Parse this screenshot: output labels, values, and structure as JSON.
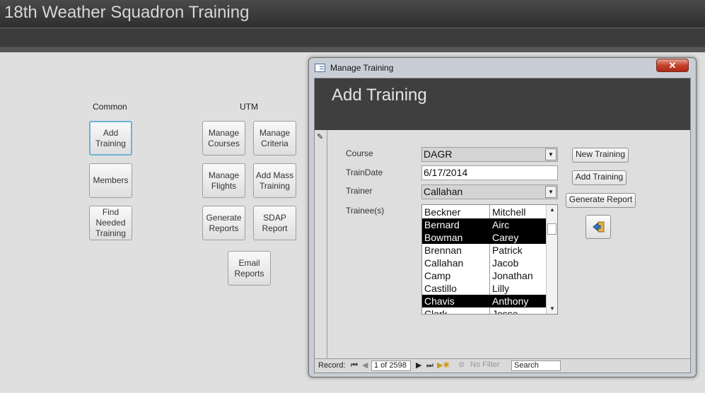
{
  "app": {
    "title": "18th Weather Squadron Training"
  },
  "groups": {
    "common_label": "Common",
    "utm_label": "UTM"
  },
  "buttons": {
    "add_training": "Add\nTraining",
    "members": "Members",
    "find_needed_training": "Find\nNeeded\nTraining",
    "manage_courses": "Manage\nCourses",
    "manage_criteria": "Manage\nCriteria",
    "manage_flights": "Manage\nFlights",
    "add_mass_training": "Add Mass\nTraining",
    "generate_reports": "Generate\nReports",
    "sdap_report": "SDAP\nReport",
    "email_reports": "Email\nReports"
  },
  "popup": {
    "window_title": "Manage Training",
    "close_glyph": "✕",
    "heading": "Add Training",
    "labels": {
      "course": "Course",
      "train_date": "TrainDate",
      "trainer": "Trainer",
      "trainees": "Trainee(s)"
    },
    "fields": {
      "course": "DAGR",
      "train_date": "6/17/2014",
      "trainer": "Callahan"
    },
    "side_buttons": {
      "new_training": "New Training",
      "add_training": "Add Training",
      "generate_report": "Generate Report"
    },
    "trainees": [
      {
        "last": "Beckner",
        "first": "Mitchell",
        "selected": false
      },
      {
        "last": "Bernard",
        "first": "Airc",
        "selected": true
      },
      {
        "last": "Bowman",
        "first": "Carey",
        "selected": true
      },
      {
        "last": "Brennan",
        "first": "Patrick",
        "selected": false
      },
      {
        "last": "Callahan",
        "first": "Jacob",
        "selected": false
      },
      {
        "last": "Camp",
        "first": "Jonathan",
        "selected": false
      },
      {
        "last": "Castillo",
        "first": "Lilly",
        "selected": false
      },
      {
        "last": "Chavis",
        "first": "Anthony",
        "selected": true
      },
      {
        "last": "Clark",
        "first": "Jesse",
        "selected": false
      }
    ],
    "nav": {
      "record_label": "Record:",
      "count": "1 of 2598",
      "no_filter": "No Filter",
      "search_placeholder": "Search"
    }
  }
}
